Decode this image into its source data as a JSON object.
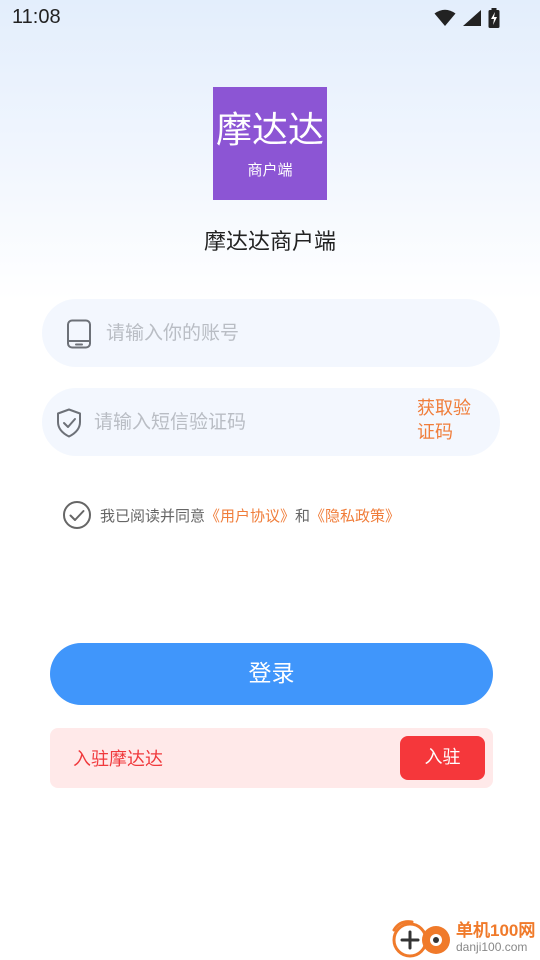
{
  "status_bar": {
    "time": "11:08",
    "icons": [
      "wifi-icon",
      "signal-icon",
      "battery-charging-icon"
    ]
  },
  "logo": {
    "main_text": "摩达达",
    "sub_text": "商户端",
    "color": "#8c55d4"
  },
  "app_title": "摩达达商户端",
  "login_form": {
    "account_placeholder": "请输入你的账号",
    "account_icon": "phone-icon",
    "code_placeholder": "请输入短信验证码",
    "code_icon": "shield-check-icon",
    "get_code_label": "获取验证码"
  },
  "agreement": {
    "checked": true,
    "prefix": "我已阅读并同意",
    "user_agreement": "《用户协议》",
    "conjunction": "和",
    "privacy_policy": "《隐私政策》"
  },
  "login_button_label": "登录",
  "join_banner": {
    "text": "入驻摩达达",
    "button_label": "入驻"
  },
  "watermark": {
    "title": "单机100网",
    "url": "danji100.com"
  },
  "colors": {
    "primary": "#4096fb",
    "accent_orange": "#f07d3a",
    "join_red": "#f5373b",
    "join_bg": "#ffe9e9",
    "field_bg": "#f3f7fe"
  }
}
